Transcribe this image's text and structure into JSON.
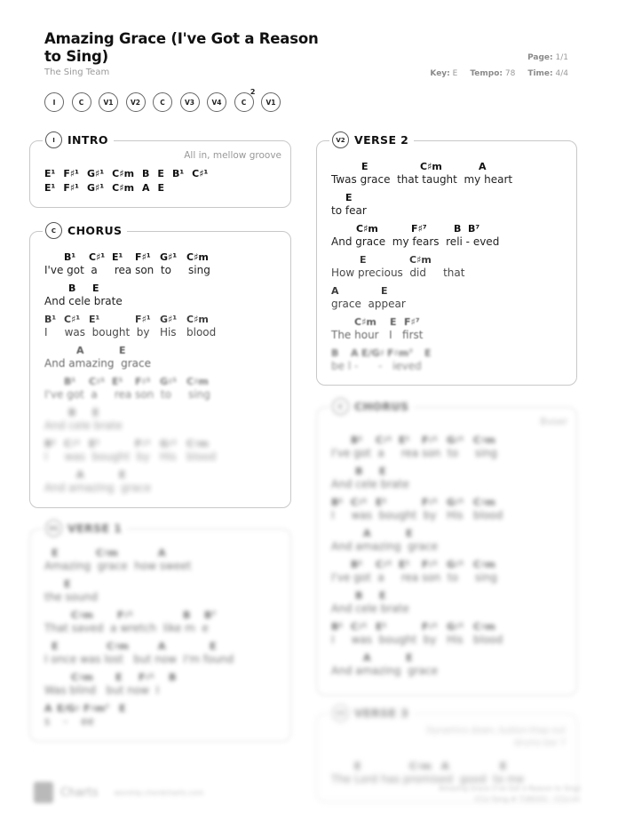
{
  "song": {
    "title": "Amazing Grace (I've Got a Reason to Sing)",
    "artist": "The Sing Team"
  },
  "meta": {
    "page_label": "Page:",
    "page_value": "1/1",
    "key_label": "Key:",
    "key_value": "E",
    "tempo_label": "Tempo:",
    "tempo_value": "78",
    "time_label": "Time:",
    "time_value": "4/4"
  },
  "roadmap": [
    {
      "label": "I",
      "sup": ""
    },
    {
      "label": "C",
      "sup": ""
    },
    {
      "label": "V1",
      "sup": ""
    },
    {
      "label": "V2",
      "sup": ""
    },
    {
      "label": "C",
      "sup": ""
    },
    {
      "label": "V3",
      "sup": ""
    },
    {
      "label": "V4",
      "sup": ""
    },
    {
      "label": "C",
      "sup": "2"
    },
    {
      "label": "V1",
      "sup": ""
    }
  ],
  "sections": {
    "intro": {
      "badge": "I",
      "title": "INTRO",
      "note": "All in, mellow groove",
      "rows": [
        [
          "E¹",
          "F♯¹",
          "G♯¹",
          "C♯m",
          "B",
          "E",
          "B¹",
          "C♯¹"
        ],
        [
          "E¹",
          "F♯¹",
          "G♯¹",
          "C♯m",
          "A",
          "E"
        ]
      ]
    },
    "chorus": {
      "badge": "C",
      "title": "CHORUS",
      "note": "",
      "lines": [
        {
          "chords": [
            "B¹",
            "C♯¹",
            "E¹",
            "F♯¹",
            "G♯¹",
            "C♯m"
          ],
          "lyric": "I've got  a     rea son  to     sing"
        },
        {
          "chords": [
            "B",
            "E"
          ],
          "lyric": "And cele brate"
        },
        {
          "chords": [
            "B¹",
            "C♯¹",
            "E¹",
            "F♯¹",
            "G♯¹",
            "C♯m"
          ],
          "lyric": "I     was  bought  by   His   blood"
        },
        {
          "chords": [
            "A",
            "E"
          ],
          "lyric": "And amazing  grace"
        },
        {
          "chords": [
            "B¹",
            "C♯¹",
            "E¹",
            "F♯¹",
            "G♯¹",
            "C♯m"
          ],
          "lyric": "I've got  a     rea son  to     sing"
        },
        {
          "chords": [
            "B",
            "E"
          ],
          "lyric": "And cele brate"
        },
        {
          "chords": [
            "B¹",
            "C♯¹",
            "E¹",
            "F♯¹",
            "G♯¹",
            "C♯m"
          ],
          "lyric": "I     was  bought  by   His   blood"
        },
        {
          "chords": [
            "A",
            "E"
          ],
          "lyric": "And amazing  grace"
        }
      ]
    },
    "verse1": {
      "badge": "V1",
      "title": "VERSE 1",
      "lines": [
        {
          "chords": [
            "E",
            "C♯m",
            "A"
          ],
          "lyric": "Amazing  grace  how sweet"
        },
        {
          "chords": [
            "E"
          ],
          "lyric": "the sound"
        },
        {
          "chords": [
            "C♯m",
            "F♯¹",
            "B",
            "B⁷"
          ],
          "lyric": "That saved  a wretch  like m  e"
        },
        {
          "chords": [
            "E",
            "C♯m",
            "A",
            "E"
          ],
          "lyric": "I once was lost   but now  I'm found"
        },
        {
          "chords": [
            "C♯m",
            "E",
            "F♯¹",
            "B"
          ],
          "lyric": "Was blind   but now  I"
        },
        {
          "chords": [
            "A",
            "E/G♯",
            "F♯m⁷",
            "E"
          ],
          "lyric": "s    -    ee"
        }
      ]
    },
    "verse2": {
      "badge": "V2",
      "title": "VERSE 2",
      "lines": [
        {
          "chords": [
            "E",
            "C♯m",
            "A"
          ],
          "lyric": "Twas grace  that taught  my heart"
        },
        {
          "chords": [
            "E"
          ],
          "lyric": "to fear"
        },
        {
          "chords": [
            "C♯m",
            "F♯⁷",
            "B",
            "B⁷"
          ],
          "lyric": "And grace  my fears  reli - eved"
        },
        {
          "chords": [
            "E",
            "C♯m"
          ],
          "lyric": "How precious  did     that"
        },
        {
          "chords": [
            "A",
            "E"
          ],
          "lyric": "grace  appear"
        },
        {
          "chords": [
            "C♯m",
            "E",
            "F♯⁷"
          ],
          "lyric": "The hour   I   first"
        },
        {
          "chords": [
            "B",
            "A",
            "E/G♯",
            "F♯m⁷",
            "E"
          ],
          "lyric": "be l -      -   ieved"
        }
      ]
    },
    "chorus2": {
      "badge": "C",
      "title": "CHORUS",
      "note": "Bvoer",
      "lines": [
        {
          "chords": [
            "B¹",
            "C♯¹",
            "E¹",
            "F♯¹",
            "G♯¹",
            "C♯m"
          ],
          "lyric": "I've got  a     rea son  to     sing"
        },
        {
          "chords": [
            "B",
            "E"
          ],
          "lyric": "And cele brate"
        },
        {
          "chords": [
            "B¹",
            "C♯¹",
            "E¹",
            "F♯¹",
            "G♯¹",
            "C♯m"
          ],
          "lyric": "I     was  bought  by   His   blood"
        },
        {
          "chords": [
            "A",
            "E"
          ],
          "lyric": "And amazing  grace"
        },
        {
          "chords": [
            "B¹",
            "C♯¹",
            "E¹",
            "F♯¹",
            "G♯¹",
            "C♯m"
          ],
          "lyric": "I've got  a     rea son  to     sing"
        },
        {
          "chords": [
            "B",
            "E"
          ],
          "lyric": "And cele brate"
        },
        {
          "chords": [
            "B¹",
            "C♯¹",
            "E¹",
            "F♯¹",
            "G♯¹",
            "C♯m"
          ],
          "lyric": "I     was  bought  by   His   blood"
        },
        {
          "chords": [
            "A",
            "E"
          ],
          "lyric": "And amazing  grace"
        }
      ]
    },
    "verse3": {
      "badge": "V3",
      "title": "VERSE 3",
      "note_line1": "Dynamics down, button-thap out",
      "note_line2": "drums bar 7",
      "lines": [
        {
          "chords": [
            "E",
            "C♯m",
            "A",
            "E"
          ],
          "lyric": "The Lord has promised  good  to me"
        }
      ]
    }
  },
  "footer": {
    "brand": "Charts",
    "url": "worship.chordcharts.com",
    "copyright_line1": "Amazing Grace (I've Got a Reason to Sing)",
    "copyright_line2": "CCLI Song # 7180201 · CCLI Lic"
  }
}
